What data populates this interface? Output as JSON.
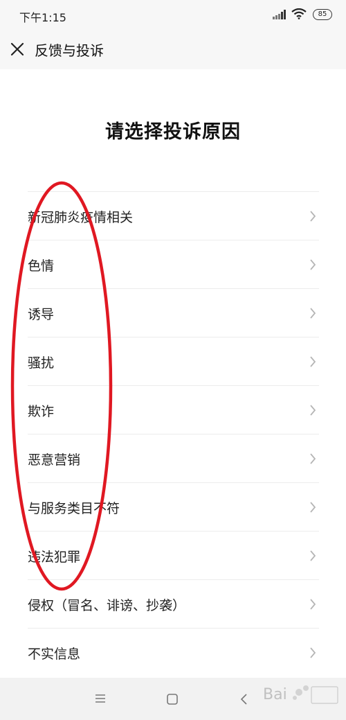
{
  "status_bar": {
    "time": "下午1:15",
    "battery": "85",
    "icons": [
      "signal-icon",
      "wifi-icon",
      "battery-icon"
    ]
  },
  "header": {
    "close_icon": "close-icon",
    "title": "反馈与投诉"
  },
  "main": {
    "title": "请选择投诉原因",
    "reasons": [
      {
        "label": "新冠肺炎疫情相关"
      },
      {
        "label": "色情"
      },
      {
        "label": "诱导"
      },
      {
        "label": "骚扰"
      },
      {
        "label": "欺诈"
      },
      {
        "label": "恶意营销"
      },
      {
        "label": "与服务类目不符"
      },
      {
        "label": "违法犯罪"
      },
      {
        "label": "侵权（冒名、诽谤、抄袭）"
      },
      {
        "label": "不实信息"
      }
    ]
  },
  "navigation": {
    "icons": [
      "menu-icon",
      "home-icon",
      "back-icon"
    ]
  },
  "colors": {
    "annotation": "#e01822",
    "chevron": "#b5b5b5",
    "separator": "#ececec"
  }
}
